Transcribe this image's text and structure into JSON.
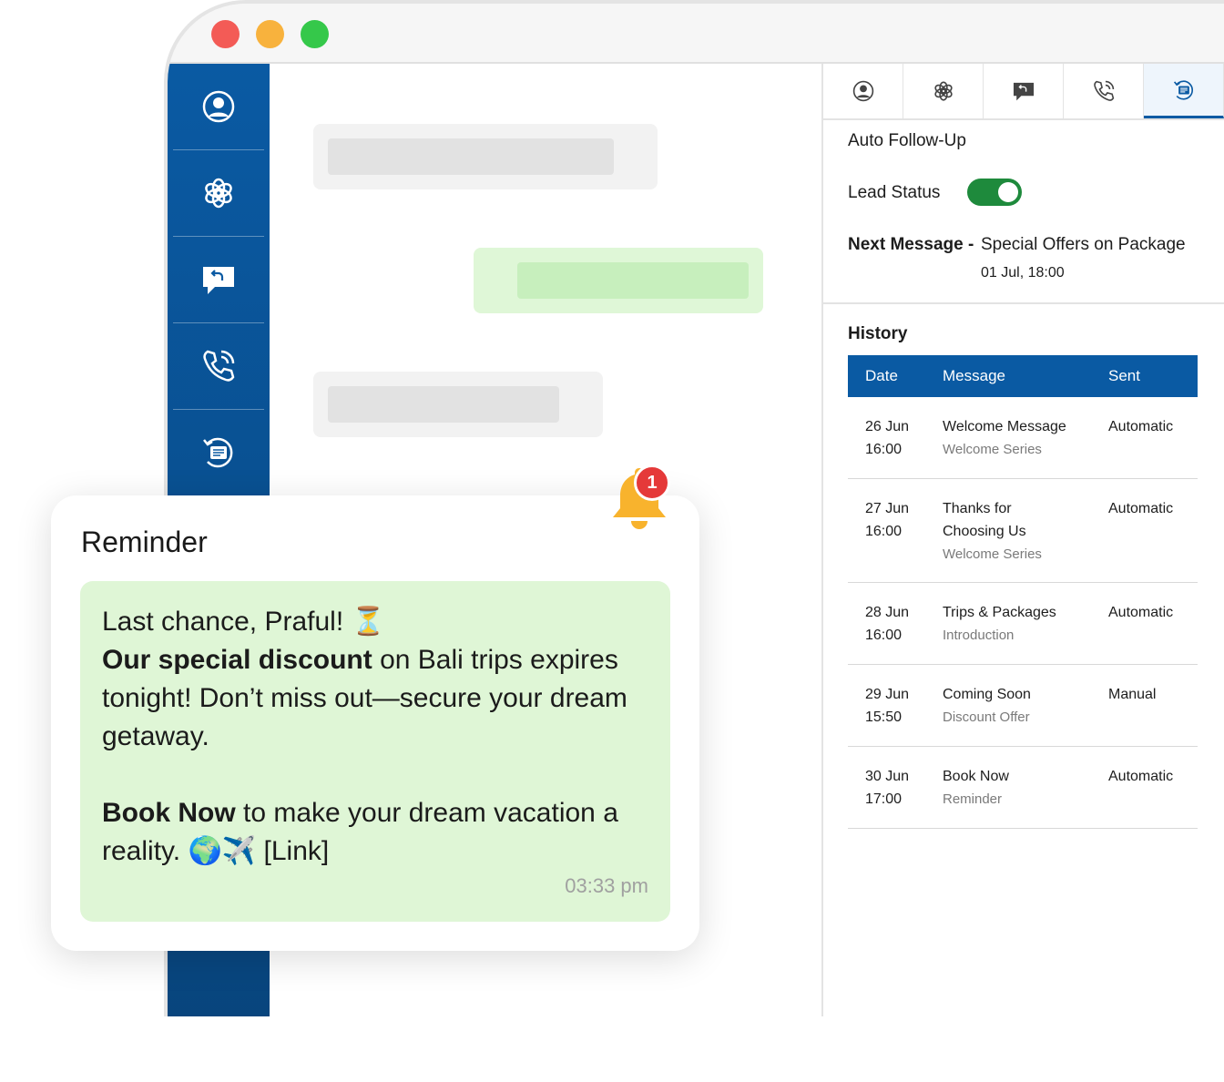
{
  "window": {
    "controls": [
      "close",
      "minimize",
      "maximize"
    ]
  },
  "sidebar": {
    "items": [
      {
        "icon": "user-circle-icon"
      },
      {
        "icon": "ai-knot-icon"
      },
      {
        "icon": "reply-chat-icon"
      },
      {
        "icon": "phone-call-icon"
      },
      {
        "icon": "follow-up-message-icon"
      }
    ]
  },
  "panel": {
    "tabs": [
      {
        "icon": "user-circle-icon"
      },
      {
        "icon": "ai-knot-icon"
      },
      {
        "icon": "reply-chat-icon"
      },
      {
        "icon": "phone-call-icon"
      },
      {
        "icon": "follow-up-message-icon",
        "active": true
      }
    ],
    "section_title": "Auto Follow-Up",
    "lead_status_label": "Lead Status",
    "lead_status_on": true,
    "next_message_label": "Next Message -",
    "next_message_value": "Special Offers on Package",
    "next_message_time": "01 Jul, 18:00",
    "history_title": "History",
    "history_headers": {
      "date": "Date",
      "message": "Message",
      "sent": "Sent"
    },
    "history": [
      {
        "date": "26 Jun",
        "time": "16:00",
        "message": "Welcome Message",
        "series": "Welcome Series",
        "sent": "Automatic"
      },
      {
        "date": "27 Jun",
        "time": "16:00",
        "message": "Thanks for Choosing Us",
        "series": "Welcome Series",
        "sent": "Automatic"
      },
      {
        "date": "28 Jun",
        "time": "16:00",
        "message": "Trips & Packages",
        "series": "Introduction",
        "sent": "Automatic"
      },
      {
        "date": "29 Jun",
        "time": "15:50",
        "message": "Coming Soon",
        "series": "Discount Offer",
        "sent": "Manual"
      },
      {
        "date": "30 Jun",
        "time": "17:00",
        "message": "Book Now",
        "series": "Reminder",
        "sent": "Automatic"
      }
    ]
  },
  "reminder": {
    "title": "Reminder",
    "greeting": "Last chance, Praful! ⏳",
    "bold1": "Our special discount",
    "text1": " on Bali trips expires tonight! Don’t miss out—secure your dream getaway.",
    "bold2": "Book Now",
    "text2": " to make your dream vacation a reality. 🌍✈️ [Link]",
    "time": "03:33 pm",
    "badge_count": "1"
  },
  "colors": {
    "primary": "#0a5aa3",
    "toggle_on": "#1e8a3c",
    "bubble_green": "#dff6d6",
    "badge_red": "#e53939",
    "bell_yellow": "#f8b32d"
  }
}
